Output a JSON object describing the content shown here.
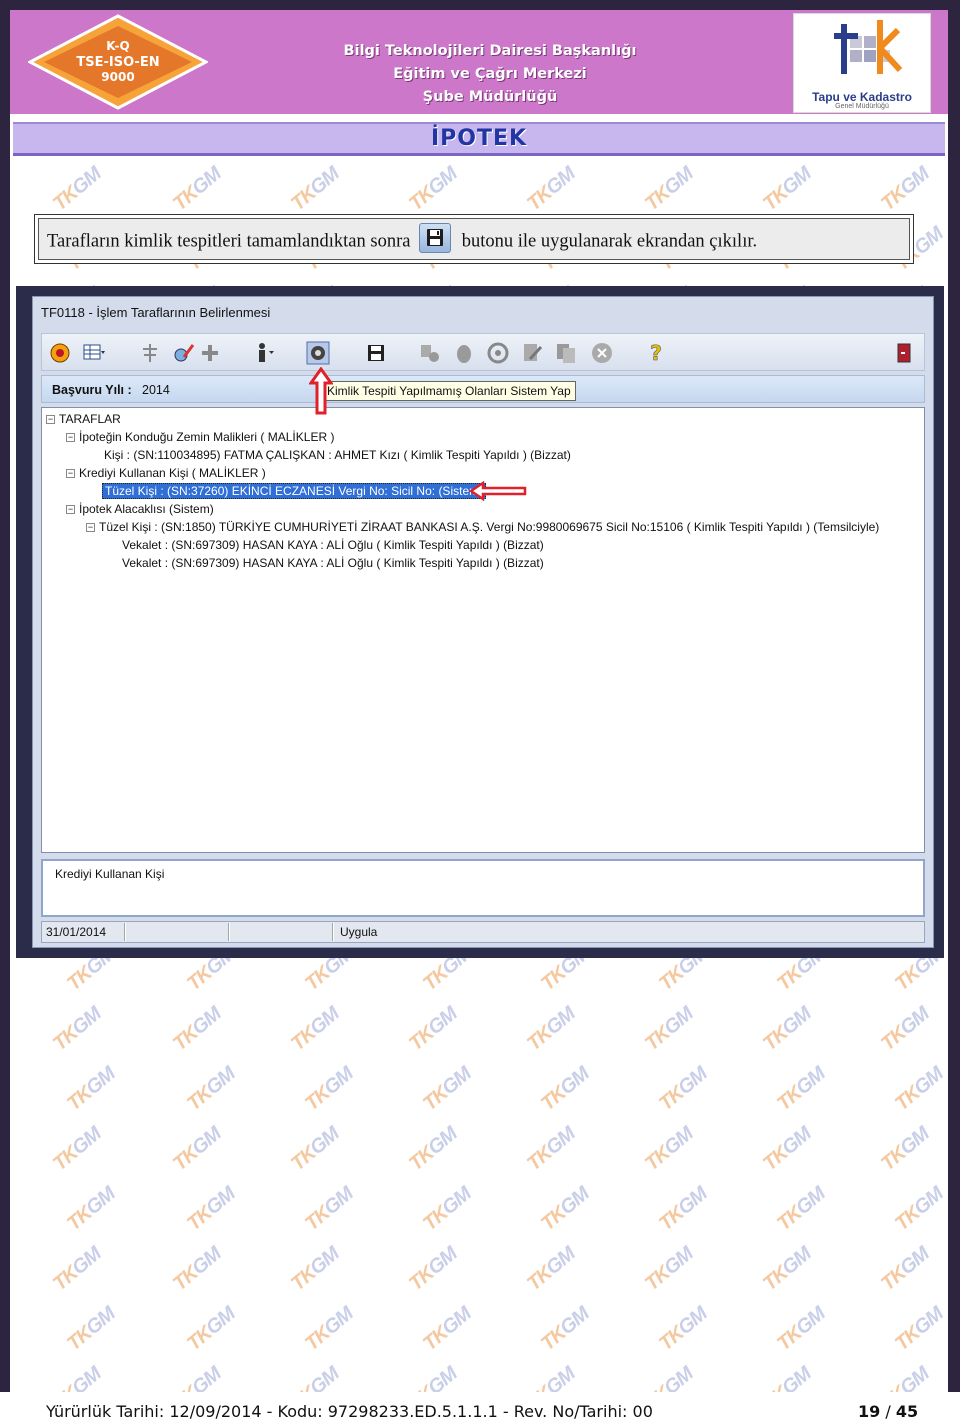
{
  "header": {
    "certificate_lines": [
      "K-Q",
      "TSE-ISO-EN",
      "9000"
    ],
    "lines": [
      "Bilgi Teknolojileri Dairesi Başkanlığı",
      "Eğitim ve Çağrı Merkezi",
      "Şube Müdürlüğü"
    ],
    "org_logo_name": "Tapu ve Kadastro",
    "org_logo_sub": "Genel Müdürlüğü",
    "section_title": "İPOTEK"
  },
  "watermark": "TK GM",
  "note": {
    "before": "Tarafların kimlik tespitleri tamamlandıktan sonra",
    "icon": "floppy-disk-icon",
    "after": "butonu ile uygulanarak ekrandan çıkılır."
  },
  "window": {
    "title": "TF0118 - İşlem Taraflarının Belirlenmesi",
    "toolbar_icons": [
      "overview-icon",
      "grid-menu-icon",
      "tree-icon",
      "edit-icon",
      "add-icon",
      "person-menu-icon",
      "gear-icon",
      "save-icon",
      "transfer-icon",
      "hand-icon",
      "refresh-icon",
      "document-edit-icon",
      "copy-icon",
      "cancel-icon",
      "help-icon",
      "exit-icon"
    ],
    "basvuru_label": "Başvuru Yılı :",
    "basvuru_value": "2014",
    "tooltip": "Kimlik Tespiti Yapılmamış Olanları Sistem Yap",
    "tree": [
      "TARAFLAR",
      "İpoteğin Konduğu Zemin Malikleri ( MALİKLER )",
      "Kişi : (SN:110034895) FATMA ÇALIŞKAN : AHMET Kızı ( Kimlik Tespiti Yapıldı ) (Bizzat)",
      "Krediyi Kullanan Kişi ( MALİKLER )",
      "Tüzel Kişi : (SN:37260) EKİNCİ ECZANESİ Vergi No: Sicil No: (Sistem)",
      "İpotek Alacaklısı (Sistem)",
      "Tüzel Kişi : (SN:1850) TÜRKİYE CUMHURİYETİ ZİRAAT BANKASI A.Ş. Vergi No:9980069675 Sicil No:15106 ( Kimlik Tespiti Yapıldı ) (Temsilciyle)",
      "Vekalet : (SN:697309) HASAN KAYA : ALİ Oğlu ( Kimlik Tespiti Yapıldı ) (Bizzat)",
      "Vekalet : (SN:697309) HASAN KAYA : ALİ Oğlu ( Kimlik Tespiti Yapıldı ) (Bizzat)"
    ],
    "bottom_label": "Krediyi Kullanan Kişi",
    "status_date": "31/01/2014",
    "status_action": "Uygula"
  },
  "colors": {
    "header_bg": "#cc77c9",
    "title_band": "#c7b7ee",
    "title_text": "#2236a3",
    "annotation_red": "#e0202a",
    "selection": "#2f6fd6"
  },
  "footer": {
    "text": "Yürürlük Tarihi: 12/09/2014  -  Kodu:  97298233.ED.5.1.1.1  -  Rev. No/Tarihi: 00",
    "page_current": "19",
    "page_sep": " / ",
    "page_total": "45"
  }
}
